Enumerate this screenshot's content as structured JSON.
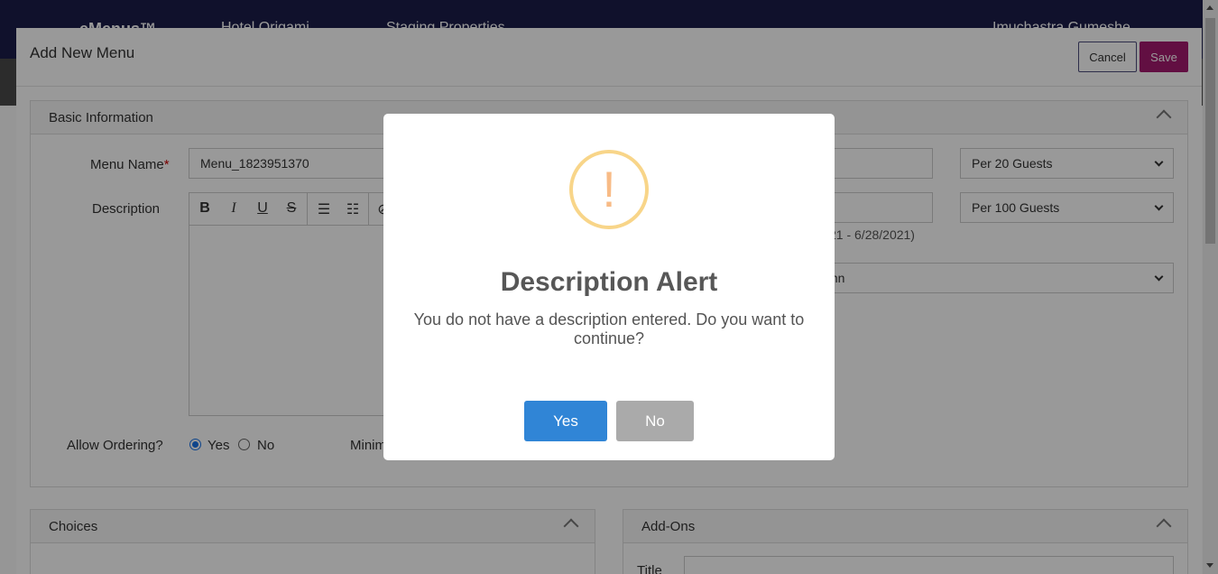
{
  "app": {
    "nav_items": [
      "eMenus™",
      "Hotel Origami",
      "Staging Properties",
      "Imuchastra Gumeshe"
    ]
  },
  "modal": {
    "title": "Add New Menu",
    "cancel_label": "Cancel",
    "save_label": "Save"
  },
  "basic_info": {
    "title": "Basic Information",
    "menu_name_label": "Menu Name",
    "menu_name_required": "*",
    "menu_name_value": "Menu_1823951370",
    "description_label": "Description",
    "toolbar_icons": [
      "bold-icon",
      "italic-icon",
      "underline-icon",
      "strikethrough-icon",
      "bullet-list-icon",
      "numbered-list-icon",
      "link-icon"
    ],
    "select_1": "Per 20 Guests",
    "select_2": "Per 100 Guests",
    "date_range_partial": "21 - 6/28/2021)",
    "select_3_partial": "mn",
    "allow_ordering_label": "Allow Ordering?",
    "yes_label": "Yes",
    "no_label": "No",
    "allow_ordering_value": "Yes",
    "minimum_partial": "Minim"
  },
  "choices": {
    "title": "Choices"
  },
  "addons": {
    "title": "Add-Ons",
    "title_field_label": "Title"
  },
  "alert": {
    "icon": "!",
    "title": "Description Alert",
    "text": "You do not have a description entered. Do you want to continue?",
    "yes_label": "Yes",
    "no_label": "No",
    "icon_color": "#f8bb86",
    "yes_color": "#3085d6",
    "no_color": "#aaaaaa"
  }
}
